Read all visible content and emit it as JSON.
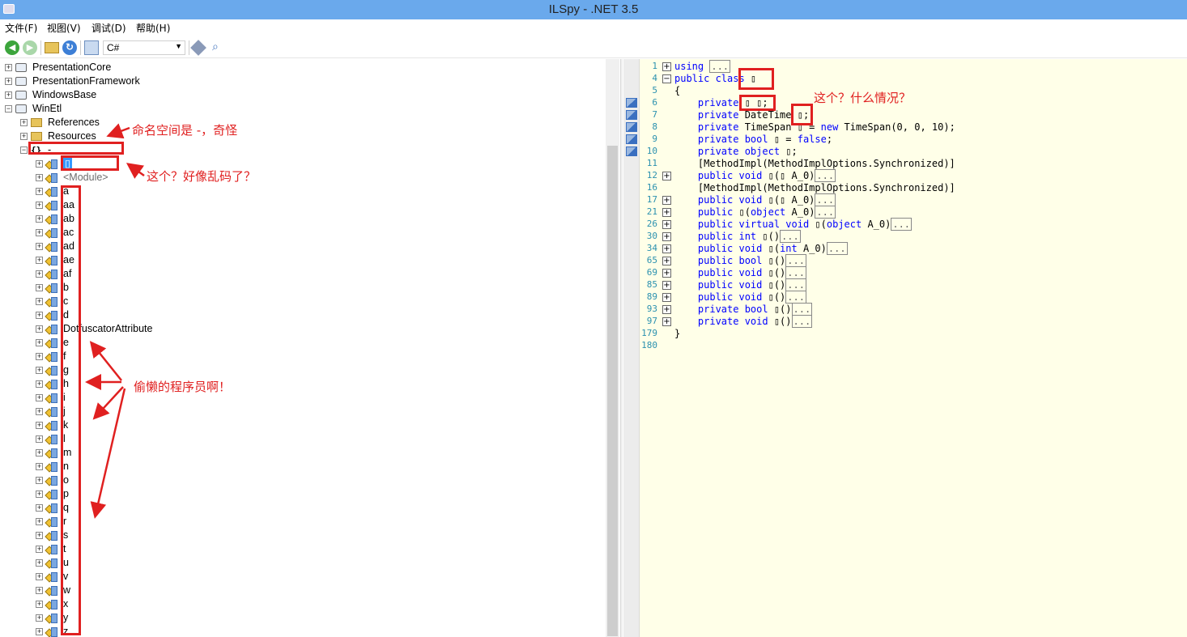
{
  "window": {
    "title": "ILSpy - .NET 3.5"
  },
  "menu": [
    {
      "label": "文件(F)"
    },
    {
      "label": "视图(V)"
    },
    {
      "label": "调试(D)"
    },
    {
      "label": "帮助(H)"
    }
  ],
  "toolbar": {
    "language": "C#",
    "buttons": [
      "back-icon",
      "forward-icon",
      "open-icon",
      "reload-icon",
      "assembly-lookup-icon",
      "navigate-icon",
      "search-icon"
    ]
  },
  "tree": {
    "assemblies": [
      {
        "label": "PresentationCore",
        "expander": "+"
      },
      {
        "label": "PresentationFramework",
        "expander": "+"
      },
      {
        "label": "WindowsBase",
        "expander": "+"
      },
      {
        "label": "WinEtl",
        "expander": "−"
      }
    ],
    "winetl_children": [
      {
        "label": "References",
        "expander": "+"
      },
      {
        "label": "Resources",
        "expander": "+"
      }
    ],
    "namespace": {
      "icon": "{}",
      "label": "-",
      "expander": "−"
    },
    "selected_type": "▯",
    "module_label": "<Module>",
    "types": [
      "a",
      "aa",
      "ab",
      "ac",
      "ad",
      "ae",
      "af",
      "b",
      "c",
      "d",
      "DotfuscatorAttribute",
      "e",
      "f",
      "g",
      "h",
      "i",
      "j",
      "k",
      "l",
      "m",
      "n",
      "o",
      "p",
      "q",
      "r",
      "s",
      "t",
      "u",
      "v",
      "w",
      "x",
      "y",
      "z"
    ]
  },
  "code": {
    "lines": [
      {
        "n": "1",
        "fold": "+",
        "parts": [
          [
            "kwn",
            "using "
          ],
          [
            "el",
            "..."
          ]
        ]
      },
      {
        "n": "4",
        "fold": "−",
        "parts": [
          [
            "kwn",
            "public class "
          ],
          [
            "ty",
            "▯"
          ]
        ]
      },
      {
        "n": "5",
        "fold": "",
        "parts": [
          [
            "ty",
            "{"
          ]
        ]
      },
      {
        "n": "6",
        "fold": "",
        "parts": [
          [
            "ty",
            "    "
          ],
          [
            "kwn",
            "private "
          ],
          [
            "ty",
            "▯ ▯;"
          ]
        ]
      },
      {
        "n": "7",
        "fold": "",
        "parts": [
          [
            "ty",
            "    "
          ],
          [
            "kwn",
            "private "
          ],
          [
            "ty",
            "DateTime ▯;"
          ]
        ]
      },
      {
        "n": "8",
        "fold": "",
        "parts": [
          [
            "ty",
            "    "
          ],
          [
            "kwn",
            "private "
          ],
          [
            "ty",
            "TimeSpan ▯ = "
          ],
          [
            "kwn",
            "new "
          ],
          [
            "ty",
            "TimeSpan(0, 0, 10);"
          ]
        ]
      },
      {
        "n": "9",
        "fold": "",
        "parts": [
          [
            "ty",
            "    "
          ],
          [
            "kwn",
            "private "
          ],
          [
            "kwn",
            "bool "
          ],
          [
            "ty",
            "▯ = "
          ],
          [
            "kwn",
            "false"
          ],
          [
            "ty",
            ";"
          ]
        ]
      },
      {
        "n": "10",
        "fold": "",
        "parts": [
          [
            "ty",
            "    "
          ],
          [
            "kwn",
            "private "
          ],
          [
            "kwn",
            "object "
          ],
          [
            "ty",
            "▯;"
          ]
        ]
      },
      {
        "n": "11",
        "fold": "",
        "parts": [
          [
            "ty",
            "    [MethodImpl(MethodImplOptions.Synchronized)]"
          ]
        ]
      },
      {
        "n": "12",
        "fold": "+",
        "parts": [
          [
            "ty",
            "    "
          ],
          [
            "kwn",
            "public void "
          ],
          [
            "ty",
            "▯(▯ A_0)"
          ],
          [
            "el",
            "..."
          ]
        ]
      },
      {
        "n": "16",
        "fold": "",
        "parts": [
          [
            "ty",
            "    [MethodImpl(MethodImplOptions.Synchronized)]"
          ]
        ]
      },
      {
        "n": "17",
        "fold": "+",
        "parts": [
          [
            "ty",
            "    "
          ],
          [
            "kwn",
            "public void "
          ],
          [
            "ty",
            "▯(▯ A_0)"
          ],
          [
            "el",
            "..."
          ]
        ]
      },
      {
        "n": "21",
        "fold": "+",
        "parts": [
          [
            "ty",
            "    "
          ],
          [
            "kwn",
            "public "
          ],
          [
            "ty",
            "▯("
          ],
          [
            "kwn",
            "object "
          ],
          [
            "ty",
            "A_0)"
          ],
          [
            "el",
            "..."
          ]
        ]
      },
      {
        "n": "26",
        "fold": "+",
        "parts": [
          [
            "ty",
            "    "
          ],
          [
            "kwn",
            "public virtual void "
          ],
          [
            "ty",
            "▯("
          ],
          [
            "kwn",
            "object "
          ],
          [
            "ty",
            "A_0)"
          ],
          [
            "el",
            "..."
          ]
        ]
      },
      {
        "n": "30",
        "fold": "+",
        "parts": [
          [
            "ty",
            "    "
          ],
          [
            "kwn",
            "public int "
          ],
          [
            "ty",
            "▯()"
          ],
          [
            "el",
            "..."
          ]
        ]
      },
      {
        "n": "34",
        "fold": "+",
        "parts": [
          [
            "ty",
            "    "
          ],
          [
            "kwn",
            "public void "
          ],
          [
            "ty",
            "▯("
          ],
          [
            "kwn",
            "int "
          ],
          [
            "ty",
            "A_0)"
          ],
          [
            "el",
            "..."
          ]
        ]
      },
      {
        "n": "65",
        "fold": "+",
        "parts": [
          [
            "ty",
            "    "
          ],
          [
            "kwn",
            "public bool "
          ],
          [
            "ty",
            "▯()"
          ],
          [
            "el",
            "..."
          ]
        ]
      },
      {
        "n": "69",
        "fold": "+",
        "parts": [
          [
            "ty",
            "    "
          ],
          [
            "kwn",
            "public void "
          ],
          [
            "ty",
            "▯()"
          ],
          [
            "el",
            "..."
          ]
        ]
      },
      {
        "n": "85",
        "fold": "+",
        "parts": [
          [
            "ty",
            "    "
          ],
          [
            "kwn",
            "public void "
          ],
          [
            "ty",
            "▯()"
          ],
          [
            "el",
            "..."
          ]
        ]
      },
      {
        "n": "89",
        "fold": "+",
        "parts": [
          [
            "ty",
            "    "
          ],
          [
            "kwn",
            "public void "
          ],
          [
            "ty",
            "▯()"
          ],
          [
            "el",
            "..."
          ]
        ]
      },
      {
        "n": "93",
        "fold": "+",
        "parts": [
          [
            "ty",
            "    "
          ],
          [
            "kwn",
            "private bool "
          ],
          [
            "ty",
            "▯()"
          ],
          [
            "el",
            "..."
          ]
        ]
      },
      {
        "n": "97",
        "fold": "+",
        "parts": [
          [
            "ty",
            "    "
          ],
          [
            "kwn",
            "private void "
          ],
          [
            "ty",
            "▯()"
          ],
          [
            "el",
            "..."
          ]
        ]
      },
      {
        "n": "179",
        "fold": "",
        "parts": [
          [
            "ty",
            "}"
          ]
        ]
      },
      {
        "n": "180",
        "fold": "",
        "parts": []
      }
    ]
  },
  "annotations": {
    "namespace_note": "命名空间是 -，奇怪",
    "garbled_note": "这个？好像乱码了？",
    "lazy_note": "偷懒的程序员啊！",
    "what_note": "这个？什么情况？"
  },
  "colors": {
    "annotation": "#e02020",
    "selection": "#3399ff",
    "code_bg": "#ffffe8",
    "keyword": "#0000ff"
  }
}
